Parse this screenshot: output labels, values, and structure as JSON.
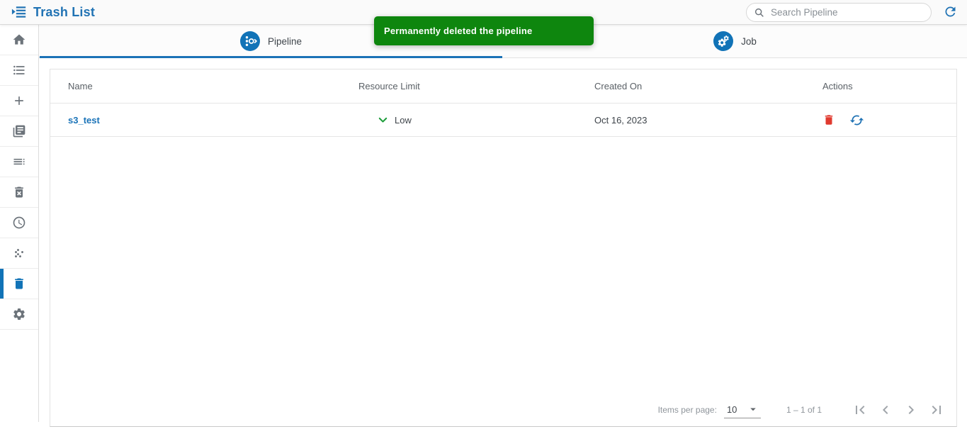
{
  "header": {
    "title": "Trash List",
    "search": {
      "placeholder": "Search Pipeline"
    }
  },
  "toast": {
    "message": "Permanently deleted the pipeline"
  },
  "tabs": [
    {
      "label": "Pipeline",
      "active": true,
      "icon": "pipeline-icon"
    },
    {
      "label": "Job",
      "active": false,
      "icon": "job-gears-icon"
    }
  ],
  "sidebar": {
    "items": [
      {
        "icon": "home-icon",
        "active": false
      },
      {
        "icon": "bulleted-list-icon",
        "active": false
      },
      {
        "icon": "plus-icon",
        "active": false
      },
      {
        "icon": "library-icon",
        "active": false
      },
      {
        "icon": "list-details-icon",
        "active": false
      },
      {
        "icon": "delete-forever-icon",
        "active": false
      },
      {
        "icon": "clock-icon",
        "active": false
      },
      {
        "icon": "cluster-icon",
        "active": false
      },
      {
        "icon": "trash-icon",
        "active": true
      },
      {
        "icon": "gear-icon",
        "active": false
      }
    ]
  },
  "table": {
    "columns": [
      "Name",
      "Resource Limit",
      "Created On",
      "Actions"
    ],
    "rows": [
      {
        "name": "s3_test",
        "resource_limit": "Low",
        "created_on": "Oct 16, 2023",
        "actions": [
          "delete",
          "restore"
        ]
      }
    ]
  },
  "pagination": {
    "items_per_page_label": "Items per page:",
    "items_per_page_value": "10",
    "range": "1 – 1 of 1"
  },
  "colors": {
    "accent_blue": "#1173b7",
    "title_blue": "#2173b4",
    "toast_green": "#0e860e",
    "link_blue": "#1a73b8",
    "chevron_green": "#1e9e3c",
    "danger_red": "#e03a2f",
    "icon_gray": "#6d747b"
  }
}
